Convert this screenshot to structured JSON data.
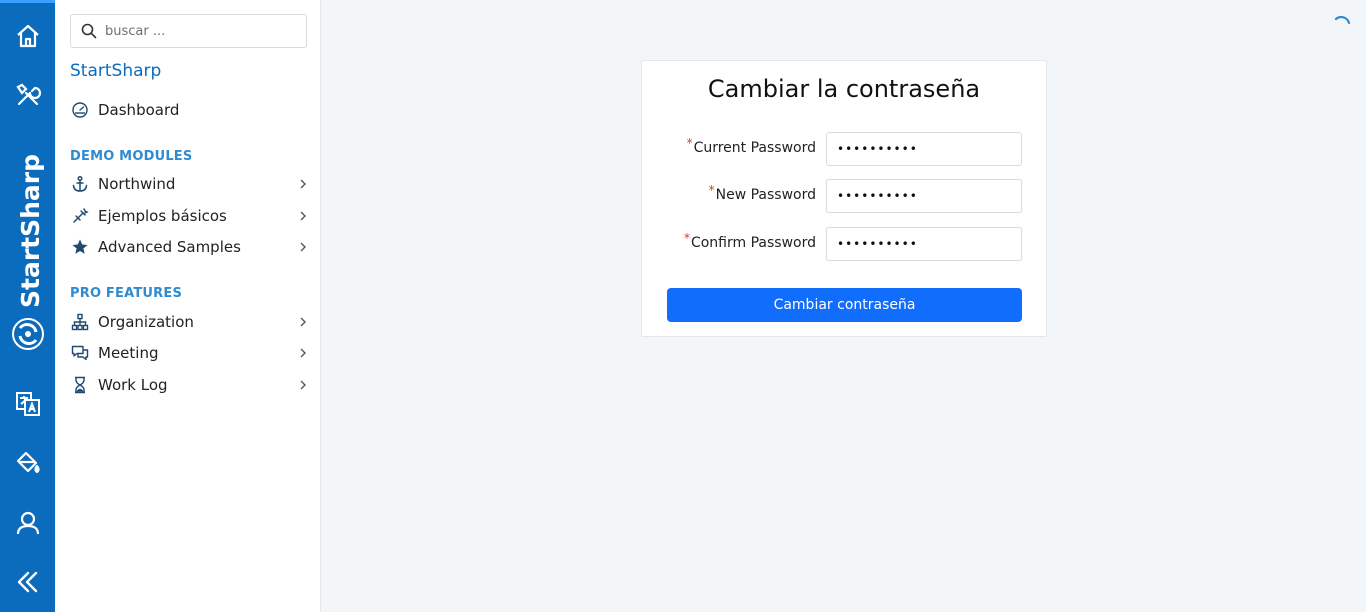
{
  "colors": {
    "rail": "#0b6bbd",
    "accent": "#116dfb",
    "section_heading": "#2e8bd0",
    "required": "#d9362b"
  },
  "rail": {
    "brand_text": "StartSharp",
    "icons": [
      "home-icon",
      "tools-icon",
      "translate-icon",
      "paint-bucket-icon",
      "user-icon",
      "collapse-icon"
    ]
  },
  "sidebar": {
    "search": {
      "placeholder": "buscar ..."
    },
    "brand": "StartSharp",
    "dashboard": {
      "label": "Dashboard",
      "icon": "gauge-icon"
    },
    "demo_modules": {
      "heading": "DEMO MODULES",
      "items": [
        {
          "label": "Northwind",
          "icon": "anchor-icon"
        },
        {
          "label": "Ejemplos básicos",
          "icon": "wand-icon"
        },
        {
          "label": "Advanced Samples",
          "icon": "star-icon"
        }
      ]
    },
    "pro_features": {
      "heading": "PRO FEATURES",
      "items": [
        {
          "label": "Organization",
          "icon": "org-chart-icon"
        },
        {
          "label": "Meeting",
          "icon": "chat-icon"
        },
        {
          "label": "Work Log",
          "icon": "hourglass-icon"
        }
      ]
    }
  },
  "form": {
    "title": "Cambiar la contraseña",
    "required_mark": "*",
    "fields": [
      {
        "label": "Current Password",
        "value": "••••••••••"
      },
      {
        "label": "New Password",
        "value": "••••••••••"
      },
      {
        "label": "Confirm Password",
        "value": "••••••••••"
      }
    ],
    "submit_label": "Cambiar contraseña"
  }
}
